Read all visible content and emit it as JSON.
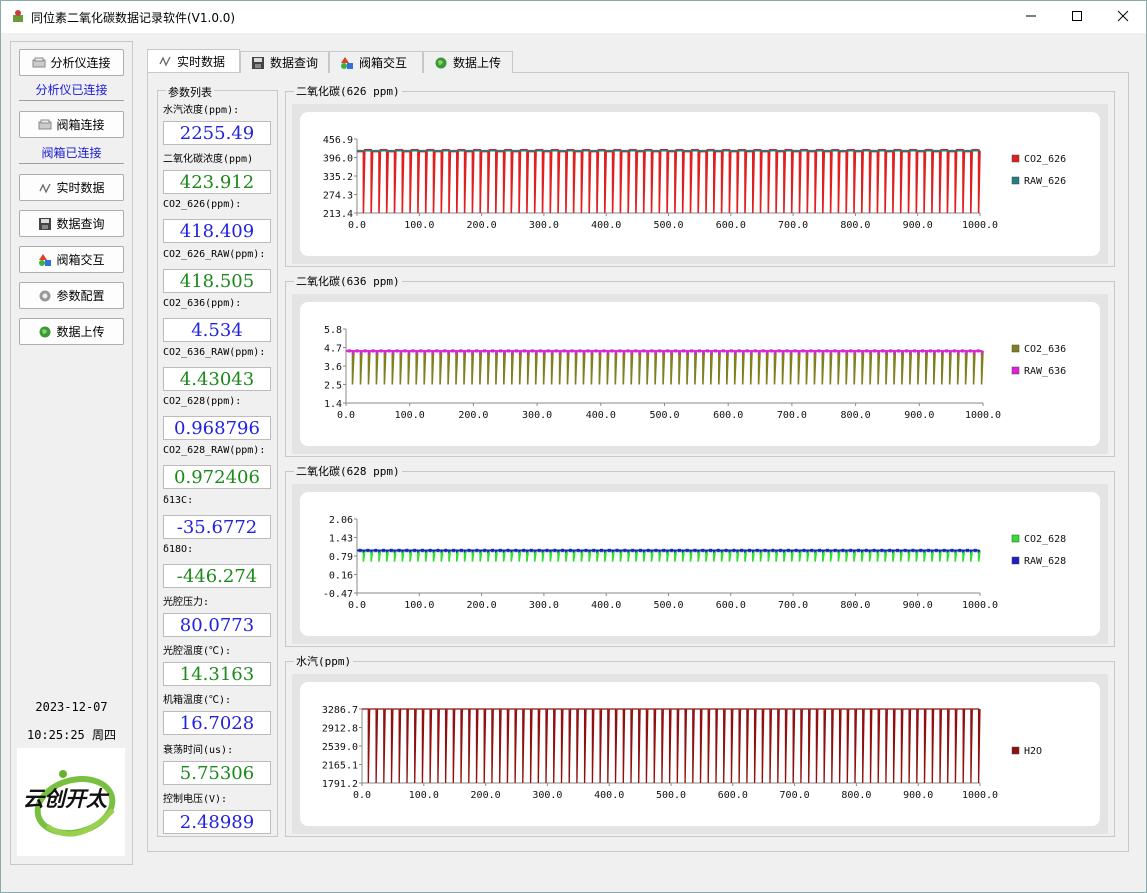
{
  "window": {
    "title": "同位素二氧化碳数据记录软件(V1.0.0)",
    "minimize_icon": "minimize-icon",
    "maximize_icon": "maximize-icon",
    "close_icon": "close-icon"
  },
  "sidebar": {
    "analyzer_connect": "分析仪连接",
    "analyzer_status": "分析仪已连接",
    "valve_connect": "阀箱连接",
    "valve_status": "阀箱已连接",
    "nav": [
      {
        "label": "实时数据",
        "icon": "line-chart-icon"
      },
      {
        "label": "数据查询",
        "icon": "disk-icon"
      },
      {
        "label": "阀箱交互",
        "icon": "shapes-icon"
      },
      {
        "label": "参数配置",
        "icon": "gear-icon"
      },
      {
        "label": "数据上传",
        "icon": "globe-icon"
      }
    ],
    "date": "2023-12-07",
    "time": "10:25:25 周四",
    "logo_text": "云创开太"
  },
  "tabs": [
    {
      "label": "实时数据",
      "icon": "line-chart-icon",
      "active": true
    },
    {
      "label": "数据查询",
      "icon": "disk-icon"
    },
    {
      "label": "阀箱交互",
      "icon": "shapes-icon"
    },
    {
      "label": "数据上传",
      "icon": "globe-icon"
    }
  ],
  "params": {
    "group_title": "参数列表",
    "items": [
      {
        "label": "水汽浓度(ppm):",
        "value": "2255.49",
        "color": "blue"
      },
      {
        "label": "二氧化碳浓度(ppm)",
        "value": "423.912",
        "color": "green"
      },
      {
        "label": "CO2_626(ppm):",
        "value": "418.409",
        "color": "blue"
      },
      {
        "label": "CO2_626_RAW(ppm):",
        "value": "418.505",
        "color": "green"
      },
      {
        "label": "CO2_636(ppm):",
        "value": "4.534",
        "color": "blue"
      },
      {
        "label": "CO2_636_RAW(ppm):",
        "value": "4.43043",
        "color": "green"
      },
      {
        "label": "CO2_628(ppm):",
        "value": "0.968796",
        "color": "blue"
      },
      {
        "label": "CO2_628_RAW(ppm):",
        "value": "0.972406",
        "color": "green"
      },
      {
        "label": "δ13C:",
        "value": "-35.6772",
        "color": "blue"
      },
      {
        "label": "δ18O:",
        "value": "-446.274",
        "color": "green"
      },
      {
        "label": "光腔压力:",
        "value": "80.0773",
        "color": "blue"
      },
      {
        "label": "光腔温度(℃):",
        "value": "14.3163",
        "color": "green"
      },
      {
        "label": "机箱温度(℃):",
        "value": "16.7028",
        "color": "blue"
      },
      {
        "label": "衰荡时间(us):",
        "value": "5.75306",
        "color": "green"
      },
      {
        "label": "控制电压(V):",
        "value": "2.48989",
        "color": "blue"
      }
    ]
  },
  "chart_data": [
    {
      "type": "line",
      "title": "二氧化碳(626 ppm)",
      "yticks": [
        "456.9",
        "396.0",
        "335.2",
        "274.3",
        "213.4"
      ],
      "ylim": [
        213.4,
        456.9
      ],
      "xticks": [
        "0.0",
        "100.0",
        "200.0",
        "300.0",
        "400.0",
        "500.0",
        "600.0",
        "700.0",
        "800.0",
        "900.0",
        "1000.0"
      ],
      "xlim": [
        0,
        1000
      ],
      "series": [
        {
          "name": "CO2_626",
          "color": "#e02020",
          "high": 418.4,
          "low": 213.4,
          "cycles": 80
        },
        {
          "name": "RAW_626",
          "color": "#208080",
          "high": 418.5,
          "low": 418.5,
          "cycles": 80
        }
      ]
    },
    {
      "type": "line",
      "title": "二氧化碳(636 ppm)",
      "yticks": [
        "5.8",
        "4.7",
        "3.6",
        "2.5",
        "1.4"
      ],
      "ylim": [
        1.4,
        5.8
      ],
      "xticks": [
        "0.0",
        "100.0",
        "200.0",
        "300.0",
        "400.0",
        "500.0",
        "600.0",
        "700.0",
        "800.0",
        "900.0",
        "1000.0"
      ],
      "xlim": [
        0,
        1000
      ],
      "series": [
        {
          "name": "CO2_636",
          "color": "#808020",
          "high": 4.5,
          "low": 2.5,
          "cycles": 80
        },
        {
          "name": "RAW_636",
          "color": "#e020e0",
          "high": 4.5,
          "low": 4.3,
          "cycles": 80
        }
      ]
    },
    {
      "type": "line",
      "title": "二氧化碳(628 ppm)",
      "yticks": [
        "2.06",
        "1.43",
        "0.79",
        "0.16",
        "-0.47"
      ],
      "ylim": [
        -0.47,
        2.06
      ],
      "xticks": [
        "0.0",
        "100.0",
        "200.0",
        "300.0",
        "400.0",
        "500.0",
        "600.0",
        "700.0",
        "800.0",
        "900.0",
        "1000.0"
      ],
      "xlim": [
        0,
        1000
      ],
      "series": [
        {
          "name": "CO2_628",
          "color": "#30e030",
          "high": 0.97,
          "low": 0.6,
          "cycles": 80
        },
        {
          "name": "RAW_628",
          "color": "#2020c0",
          "high": 0.99,
          "low": 0.95,
          "cycles": 80
        }
      ]
    },
    {
      "type": "line",
      "title": "水汽(ppm)",
      "yticks": [
        "3286.7",
        "2912.8",
        "2539.0",
        "2165.1",
        "1791.2"
      ],
      "ylim": [
        1791.2,
        3286.7
      ],
      "xticks": [
        "0.0",
        "100.0",
        "200.0",
        "300.0",
        "400.0",
        "500.0",
        "600.0",
        "700.0",
        "800.0",
        "900.0",
        "1000.0"
      ],
      "xlim": [
        0,
        1000
      ],
      "series": [
        {
          "name": "H2O",
          "color": "#901010",
          "high": 3286.7,
          "low": 1791.2,
          "cycles": 80
        }
      ]
    }
  ]
}
